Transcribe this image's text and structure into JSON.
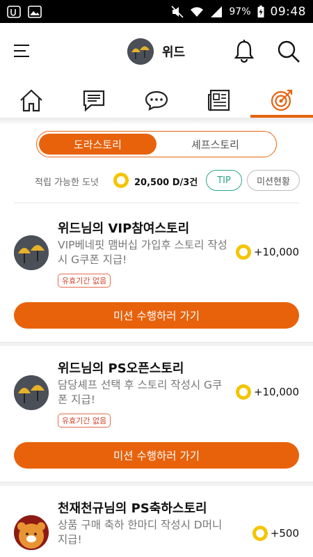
{
  "status_bar": {
    "battery": "97%",
    "time": "09:48"
  },
  "header": {
    "username": "위드"
  },
  "tabs": [
    {
      "icon": "home-icon"
    },
    {
      "icon": "chat-list-icon"
    },
    {
      "icon": "speech-bubble-icon"
    },
    {
      "icon": "news-icon"
    },
    {
      "icon": "target-icon",
      "active": true
    }
  ],
  "segment": {
    "options": [
      "도라스토리",
      "셰프스토리"
    ],
    "selected": "도라스토리"
  },
  "points": {
    "label": "적립 가능한 도넛",
    "value": "20,500 D/3건",
    "tip_button": "TIP",
    "mission_status_button": "미션현황"
  },
  "missions": [
    {
      "title": "위드님의 VIP참여스토리",
      "description": "VIP베네핏 맴버십 가입후 스토리 작성시 G쿠폰 지급!",
      "reward": "+10,000",
      "badge": "유효기간 없음",
      "action": "미션 수행하러 가기"
    },
    {
      "title": "위드님의 PS오픈스토리",
      "description": "담당셰프 선택 후 스토리 작성시 G쿠폰 지급!",
      "reward": "+10,000",
      "badge": "유효기간 없음",
      "action": "미션 수행하러 가기"
    },
    {
      "title": "천재천규님의 PS축하스토리",
      "description": "상품 구매 축하 한마디 작성시 D머니 지급!",
      "reward": "+500"
    }
  ],
  "colors": {
    "accent": "#e8620c",
    "tip": "#2aa58d",
    "coin": "#f5c400",
    "badge": "#d2452c"
  }
}
